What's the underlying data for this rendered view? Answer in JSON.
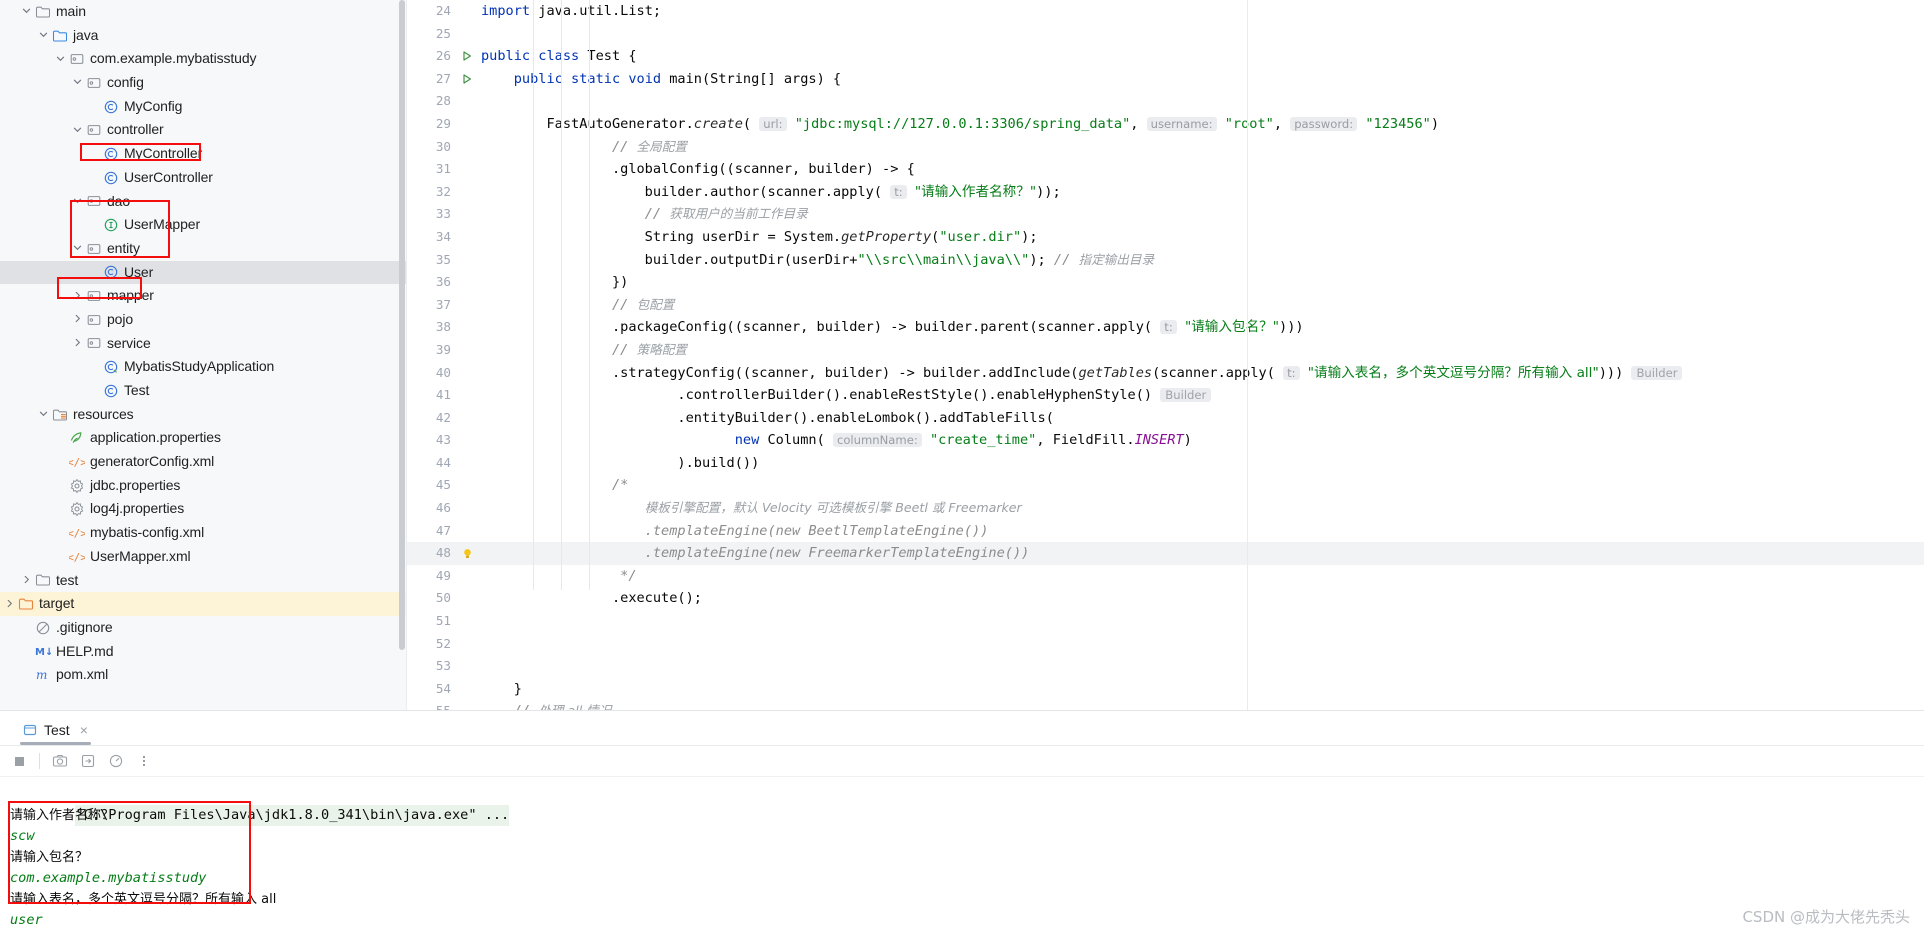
{
  "project_tree": {
    "scrollbar": "vertical-scrollbar",
    "items": [
      {
        "label": "main",
        "icon": "folder-icon",
        "indent": 1,
        "arrow": "down",
        "type": "folder"
      },
      {
        "label": "java",
        "icon": "folder-source-icon",
        "indent": 2,
        "arrow": "down",
        "type": "folder-src"
      },
      {
        "label": "com.example.mybatisstudy",
        "icon": "package-icon",
        "indent": 3,
        "arrow": "down",
        "type": "package"
      },
      {
        "label": "config",
        "icon": "package-icon",
        "indent": 4,
        "arrow": "down",
        "type": "package"
      },
      {
        "label": "MyConfig",
        "icon": "class-icon",
        "indent": 5,
        "arrow": "none",
        "type": "class"
      },
      {
        "label": "controller",
        "icon": "package-icon",
        "indent": 4,
        "arrow": "down",
        "type": "package"
      },
      {
        "label": "MyController",
        "icon": "class-icon",
        "indent": 5,
        "arrow": "none",
        "type": "class"
      },
      {
        "label": "UserController",
        "icon": "class-icon",
        "indent": 5,
        "arrow": "none",
        "type": "class",
        "boxed": true
      },
      {
        "label": "dao",
        "icon": "package-icon",
        "indent": 4,
        "arrow": "down",
        "type": "package"
      },
      {
        "label": "UserMapper",
        "icon": "interface-icon",
        "indent": 5,
        "arrow": "none",
        "type": "interface"
      },
      {
        "label": "entity",
        "icon": "package-icon",
        "indent": 4,
        "arrow": "down",
        "type": "package"
      },
      {
        "label": "User",
        "icon": "class-icon",
        "indent": 5,
        "arrow": "none",
        "type": "class",
        "selected": true
      },
      {
        "label": "mapper",
        "icon": "package-icon",
        "indent": 4,
        "arrow": "right",
        "type": "package"
      },
      {
        "label": "pojo",
        "icon": "package-icon",
        "indent": 4,
        "arrow": "right",
        "type": "package"
      },
      {
        "label": "service",
        "icon": "package-icon",
        "indent": 4,
        "arrow": "right",
        "type": "package"
      },
      {
        "label": "MybatisStudyApplication",
        "icon": "spring-class-icon",
        "indent": 5,
        "arrow": "none",
        "type": "spring"
      },
      {
        "label": "Test",
        "icon": "class-icon",
        "indent": 5,
        "arrow": "none",
        "type": "class"
      },
      {
        "label": "resources",
        "icon": "folder-resources-icon",
        "indent": 2,
        "arrow": "down",
        "type": "folder-res"
      },
      {
        "label": "application.properties",
        "icon": "spring-properties-icon",
        "indent": 3,
        "arrow": "none",
        "type": "spring-props"
      },
      {
        "label": "generatorConfig.xml",
        "icon": "xml-icon",
        "indent": 3,
        "arrow": "none",
        "type": "xml"
      },
      {
        "label": "jdbc.properties",
        "icon": "properties-icon",
        "indent": 3,
        "arrow": "none",
        "type": "props"
      },
      {
        "label": "log4j.properties",
        "icon": "properties-icon",
        "indent": 3,
        "arrow": "none",
        "type": "props"
      },
      {
        "label": "mybatis-config.xml",
        "icon": "xml-icon",
        "indent": 3,
        "arrow": "none",
        "type": "xml"
      },
      {
        "label": "UserMapper.xml",
        "icon": "xml-icon",
        "indent": 3,
        "arrow": "none",
        "type": "xml"
      },
      {
        "label": "test",
        "icon": "folder-icon",
        "indent": 1,
        "arrow": "right",
        "type": "folder"
      },
      {
        "label": "target",
        "icon": "folder-target-icon",
        "indent": 0,
        "arrow": "right",
        "type": "folder-target",
        "highlight": true
      },
      {
        "label": ".gitignore",
        "icon": "gitignore-icon",
        "indent": 1,
        "arrow": "none",
        "type": "ignore"
      },
      {
        "label": "HELP.md",
        "icon": "markdown-icon",
        "indent": 1,
        "arrow": "none",
        "type": "md"
      },
      {
        "label": "pom.xml",
        "icon": "maven-icon",
        "indent": 1,
        "arrow": "none",
        "type": "maven"
      }
    ],
    "annotations": [
      {
        "name": "usercontroller-box"
      },
      {
        "name": "entity-mapper-box"
      },
      {
        "name": "service-box"
      }
    ]
  },
  "editor": {
    "first_line_number": 24,
    "current_line": 48,
    "lines": [
      {
        "n": 24,
        "segments": [
          {
            "t": "import ",
            "c": "kw"
          },
          {
            "t": "java.util.List;",
            "c": "plain"
          }
        ]
      },
      {
        "n": 25,
        "segments": []
      },
      {
        "n": 26,
        "run": true,
        "segments": [
          {
            "t": "public class ",
            "c": "kw"
          },
          {
            "t": "Test {",
            "c": "plain"
          }
        ]
      },
      {
        "n": 27,
        "run": true,
        "segments": [
          {
            "t": "    ",
            "c": "plain"
          },
          {
            "t": "public static void ",
            "c": "kw"
          },
          {
            "t": "main(String[] args) {",
            "c": "plain"
          }
        ]
      },
      {
        "n": 28,
        "segments": []
      },
      {
        "n": 29,
        "segments": [
          {
            "t": "        FastAutoGenerator.",
            "c": "plain"
          },
          {
            "t": "create",
            "c": "ital"
          },
          {
            "t": "( ",
            "c": "plain"
          },
          {
            "t": "url:",
            "c": "hint"
          },
          {
            "t": " ",
            "c": "plain"
          },
          {
            "t": "\"jdbc:mysql://127.0.0.1:3306/spring_data\"",
            "c": "str"
          },
          {
            "t": ", ",
            "c": "plain"
          },
          {
            "t": "username:",
            "c": "hint"
          },
          {
            "t": " ",
            "c": "plain"
          },
          {
            "t": "\"root\"",
            "c": "str"
          },
          {
            "t": ", ",
            "c": "plain"
          },
          {
            "t": "password:",
            "c": "hint"
          },
          {
            "t": " ",
            "c": "plain"
          },
          {
            "t": "\"123456\"",
            "c": "str"
          },
          {
            "t": ")",
            "c": "plain"
          }
        ]
      },
      {
        "n": 30,
        "segments": [
          {
            "t": "                ",
            "c": "plain"
          },
          {
            "t": "// ",
            "c": "cmt"
          },
          {
            "t": "全局配置",
            "c": "cmt-cn"
          }
        ]
      },
      {
        "n": 31,
        "segments": [
          {
            "t": "                .globalConfig((scanner, builder) -> {",
            "c": "plain"
          }
        ]
      },
      {
        "n": 32,
        "segments": [
          {
            "t": "                    builder.author(scanner.apply( ",
            "c": "plain"
          },
          {
            "t": "t:",
            "c": "hint"
          },
          {
            "t": " ",
            "c": "plain"
          },
          {
            "t": "\"请输入作者名称？\"",
            "c": "str cn"
          },
          {
            "t": "));",
            "c": "plain"
          }
        ]
      },
      {
        "n": 33,
        "segments": [
          {
            "t": "                    ",
            "c": "plain"
          },
          {
            "t": "// ",
            "c": "cmt"
          },
          {
            "t": "获取用户的当前工作目录",
            "c": "cmt-cn"
          }
        ]
      },
      {
        "n": 34,
        "segments": [
          {
            "t": "                    String userDir = System.",
            "c": "plain"
          },
          {
            "t": "getProperty",
            "c": "ital"
          },
          {
            "t": "(",
            "c": "plain"
          },
          {
            "t": "\"user.dir\"",
            "c": "str"
          },
          {
            "t": ");",
            "c": "plain"
          }
        ]
      },
      {
        "n": 35,
        "segments": [
          {
            "t": "                    builder.outputDir(userDir+",
            "c": "plain"
          },
          {
            "t": "\"\\\\src\\\\main\\\\java\\\\\"",
            "c": "str"
          },
          {
            "t": "); ",
            "c": "plain"
          },
          {
            "t": "// ",
            "c": "cmt"
          },
          {
            "t": "指定输出目录",
            "c": "cmt-cn"
          }
        ]
      },
      {
        "n": 36,
        "segments": [
          {
            "t": "                })",
            "c": "plain"
          }
        ]
      },
      {
        "n": 37,
        "segments": [
          {
            "t": "                ",
            "c": "plain"
          },
          {
            "t": "// ",
            "c": "cmt"
          },
          {
            "t": "包配置",
            "c": "cmt-cn"
          }
        ]
      },
      {
        "n": 38,
        "segments": [
          {
            "t": "                .packageConfig((scanner, builder) -> builder.parent(scanner.apply( ",
            "c": "plain"
          },
          {
            "t": "t:",
            "c": "hint"
          },
          {
            "t": " ",
            "c": "plain"
          },
          {
            "t": "\"请输入包名？\"",
            "c": "str cn"
          },
          {
            "t": ")))",
            "c": "plain"
          }
        ]
      },
      {
        "n": 39,
        "segments": [
          {
            "t": "                ",
            "c": "plain"
          },
          {
            "t": "// ",
            "c": "cmt"
          },
          {
            "t": "策略配置",
            "c": "cmt-cn"
          }
        ]
      },
      {
        "n": 40,
        "segments": [
          {
            "t": "                .strategyConfig((scanner, builder) -> builder.addInclude(",
            "c": "plain"
          },
          {
            "t": "getTables",
            "c": "ital"
          },
          {
            "t": "(scanner.apply( ",
            "c": "plain"
          },
          {
            "t": "t:",
            "c": "hint"
          },
          {
            "t": " ",
            "c": "plain"
          },
          {
            "t": "\"请输入表名，多个英文逗号分隔？所有输入 all\"",
            "c": "str cn"
          },
          {
            "t": ")))",
            "c": "plain"
          },
          {
            "t": " ",
            "c": "plain"
          },
          {
            "t": "Builder",
            "c": "hintdim"
          }
        ]
      },
      {
        "n": 41,
        "segments": [
          {
            "t": "                        .controllerBuilder().enableRestStyle().enableHyphenStyle()",
            "c": "plain"
          },
          {
            "t": " ",
            "c": "plain"
          },
          {
            "t": "Builder",
            "c": "hintdim"
          }
        ]
      },
      {
        "n": 42,
        "segments": [
          {
            "t": "                        .entityBuilder().enableLombok().addTableFills(",
            "c": "plain"
          }
        ]
      },
      {
        "n": 43,
        "segments": [
          {
            "t": "                               ",
            "c": "plain"
          },
          {
            "t": "new ",
            "c": "kw"
          },
          {
            "t": "Column( ",
            "c": "plain"
          },
          {
            "t": "columnName:",
            "c": "hint"
          },
          {
            "t": " ",
            "c": "plain"
          },
          {
            "t": "\"create_time\"",
            "c": "str"
          },
          {
            "t": ", FieldFill.",
            "c": "plain"
          },
          {
            "t": "INSERT",
            "c": "fld"
          },
          {
            "t": ")",
            "c": "plain"
          }
        ]
      },
      {
        "n": 44,
        "segments": [
          {
            "t": "                        ).build())",
            "c": "plain"
          }
        ]
      },
      {
        "n": 45,
        "segments": [
          {
            "t": "                /*",
            "c": "cmt"
          }
        ]
      },
      {
        "n": 46,
        "segments": [
          {
            "t": "                    ",
            "c": "cmt"
          },
          {
            "t": "模板引擎配置，默认 Velocity 可选模板引擎 Beetl 或 Freemarker",
            "c": "cmt-cn"
          }
        ]
      },
      {
        "n": 47,
        "segments": [
          {
            "t": "                    .templateEngine(new BeetlTemplateEngine())",
            "c": "cmt"
          }
        ]
      },
      {
        "n": 48,
        "bulb": true,
        "current": true,
        "segments": [
          {
            "t": "                    .templateEngine(new FreemarkerTemplateEngine())",
            "c": "cmt"
          }
        ]
      },
      {
        "n": 49,
        "segments": [
          {
            "t": "                 */",
            "c": "cmt"
          }
        ]
      },
      {
        "n": 50,
        "segments": [
          {
            "t": "                .execute();",
            "c": "plain"
          }
        ]
      },
      {
        "n": 51,
        "segments": []
      },
      {
        "n": 52,
        "segments": []
      },
      {
        "n": 53,
        "segments": []
      },
      {
        "n": 54,
        "segments": [
          {
            "t": "    }",
            "c": "plain"
          }
        ]
      },
      {
        "n": 55,
        "segments": [
          {
            "t": "    ",
            "c": "plain"
          },
          {
            "t": "// ",
            "c": "cmt"
          },
          {
            "t": "处理 all 情况",
            "c": "cmt-cn"
          }
        ]
      }
    ]
  },
  "run_panel": {
    "tab_label": "Test",
    "tab_icon": "run-config-icon",
    "tab_close": "×",
    "toolbar": [
      {
        "name": "stop-button",
        "icon": "stop-icon"
      },
      {
        "name": "screenshot-button",
        "icon": "camera-icon"
      },
      {
        "name": "export-button",
        "icon": "export-icon"
      },
      {
        "name": "profiler-button",
        "icon": "gauge-icon"
      },
      {
        "name": "more-button",
        "icon": "more-vertical-icon"
      }
    ],
    "console": {
      "command": "\"C:\\Program Files\\Java\\jdk1.8.0_341\\bin\\java.exe\" ...",
      "lines": [
        {
          "text": "请输入作者名称？",
          "kind": "prompt"
        },
        {
          "text": "scw",
          "kind": "input"
        },
        {
          "text": "请输入包名？",
          "kind": "prompt"
        },
        {
          "text": "com.example.mybatisstudy",
          "kind": "input"
        },
        {
          "text": "请输入表名，多个英文逗号分隔？所有输入 all",
          "kind": "prompt"
        },
        {
          "text": "user",
          "kind": "input"
        }
      ]
    }
  },
  "watermark": "CSDN @成为大佬先秃头",
  "colors": {
    "accent_red": "#f40d0d",
    "keyword": "#0033b3",
    "string": "#067d17",
    "comment": "#8c8c8c",
    "selection": "#dfe1e5",
    "highlight": "#fdf3d6"
  }
}
